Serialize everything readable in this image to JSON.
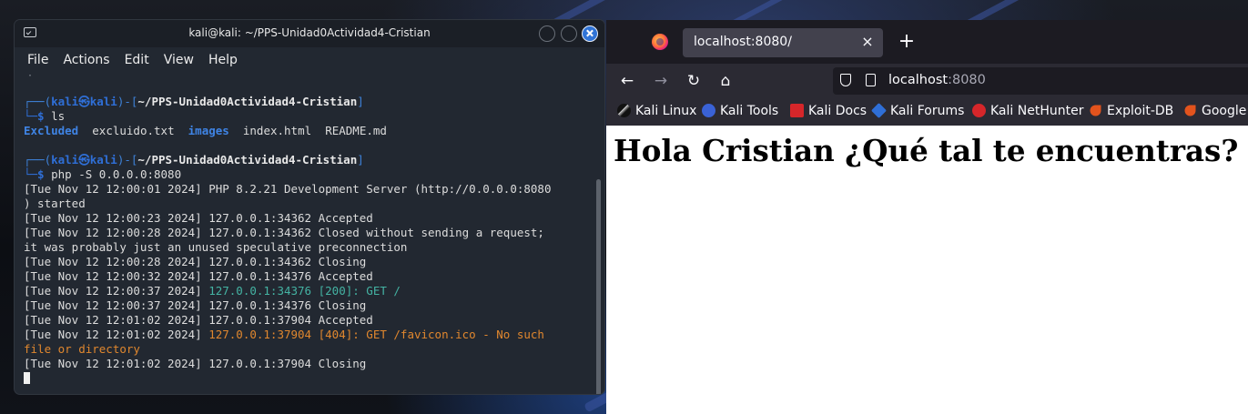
{
  "terminal": {
    "title": "kali@kali: ~/PPS-Unidad0Actividad4-Cristian",
    "menu": [
      "File",
      "Actions",
      "Edit",
      "View",
      "Help"
    ],
    "top_remnant": "·",
    "prompt1": {
      "frame_open": "┌──(",
      "user": "kali㉿kali",
      "frame_mid": ")-[",
      "path": "~/PPS-Unidad0Actividad4-Cristian",
      "frame_close": "]",
      "dollar": "└─$ ",
      "command": "ls"
    },
    "ls_output": {
      "dir1": "Excluded",
      "file1": "excluido.txt",
      "dir2": "images",
      "file2": "index.html",
      "file3": "README.md"
    },
    "prompt2": {
      "frame_open": "┌──(",
      "user": "kali㉿kali",
      "frame_mid": ")-[",
      "path": "~/PPS-Unidad0Actividad4-Cristian",
      "frame_close": "]",
      "dollar": "└─$ ",
      "command": "php -S 0.0.0.0:8080"
    },
    "log": {
      "l1": "[Tue Nov 12 12:00:01 2024] PHP 8.2.21 Development Server (http://0.0.0.0:8080",
      "l2": ") started",
      "l3": "[Tue Nov 12 12:00:23 2024] 127.0.0.1:34362 Accepted",
      "l4": "[Tue Nov 12 12:00:28 2024] 127.0.0.1:34362 Closed without sending a request;",
      "l5": "it was probably just an unused speculative preconnection",
      "l6": "[Tue Nov 12 12:00:28 2024] 127.0.0.1:34362 Closing",
      "l7": "[Tue Nov 12 12:00:32 2024] 127.0.0.1:34376 Accepted",
      "l8_prefix": "[Tue Nov 12 12:00:37 2024] ",
      "l8_colored": "127.0.0.1:34376 [200]: GET /",
      "l9": "[Tue Nov 12 12:00:37 2024] 127.0.0.1:34376 Closing",
      "l10": "[Tue Nov 12 12:01:02 2024] 127.0.0.1:37904 Accepted",
      "l11_prefix": "[Tue Nov 12 12:01:02 2024] ",
      "l11_colored": "127.0.0.1:37904 [404]: GET /favicon.ico - No such",
      "l12_colored": "file or directory",
      "l13": "[Tue Nov 12 12:01:02 2024] 127.0.0.1:37904 Closing"
    }
  },
  "browser": {
    "tab_title": "localhost:8080/",
    "tab_close": "×",
    "new_tab": "+",
    "nav": {
      "back": "←",
      "forward": "→",
      "reload": "↻",
      "home": "⌂"
    },
    "url_host": "localhost",
    "url_port": ":8080",
    "bookmarks": [
      "Kali Linux",
      "Kali Tools",
      "Kali Docs",
      "Kali Forums",
      "Kali NetHunter",
      "Exploit-DB",
      "Google"
    ],
    "page_heading": "Hola Cristian ¿Qué tal te encuentras?"
  },
  "colors": {
    "terminal_bg": "#222831",
    "prompt_blue": "#2f6fd7",
    "ok_teal": "#44b3a3",
    "warn_orange": "#e0872e",
    "browser_chrome": "#2b2a33"
  }
}
